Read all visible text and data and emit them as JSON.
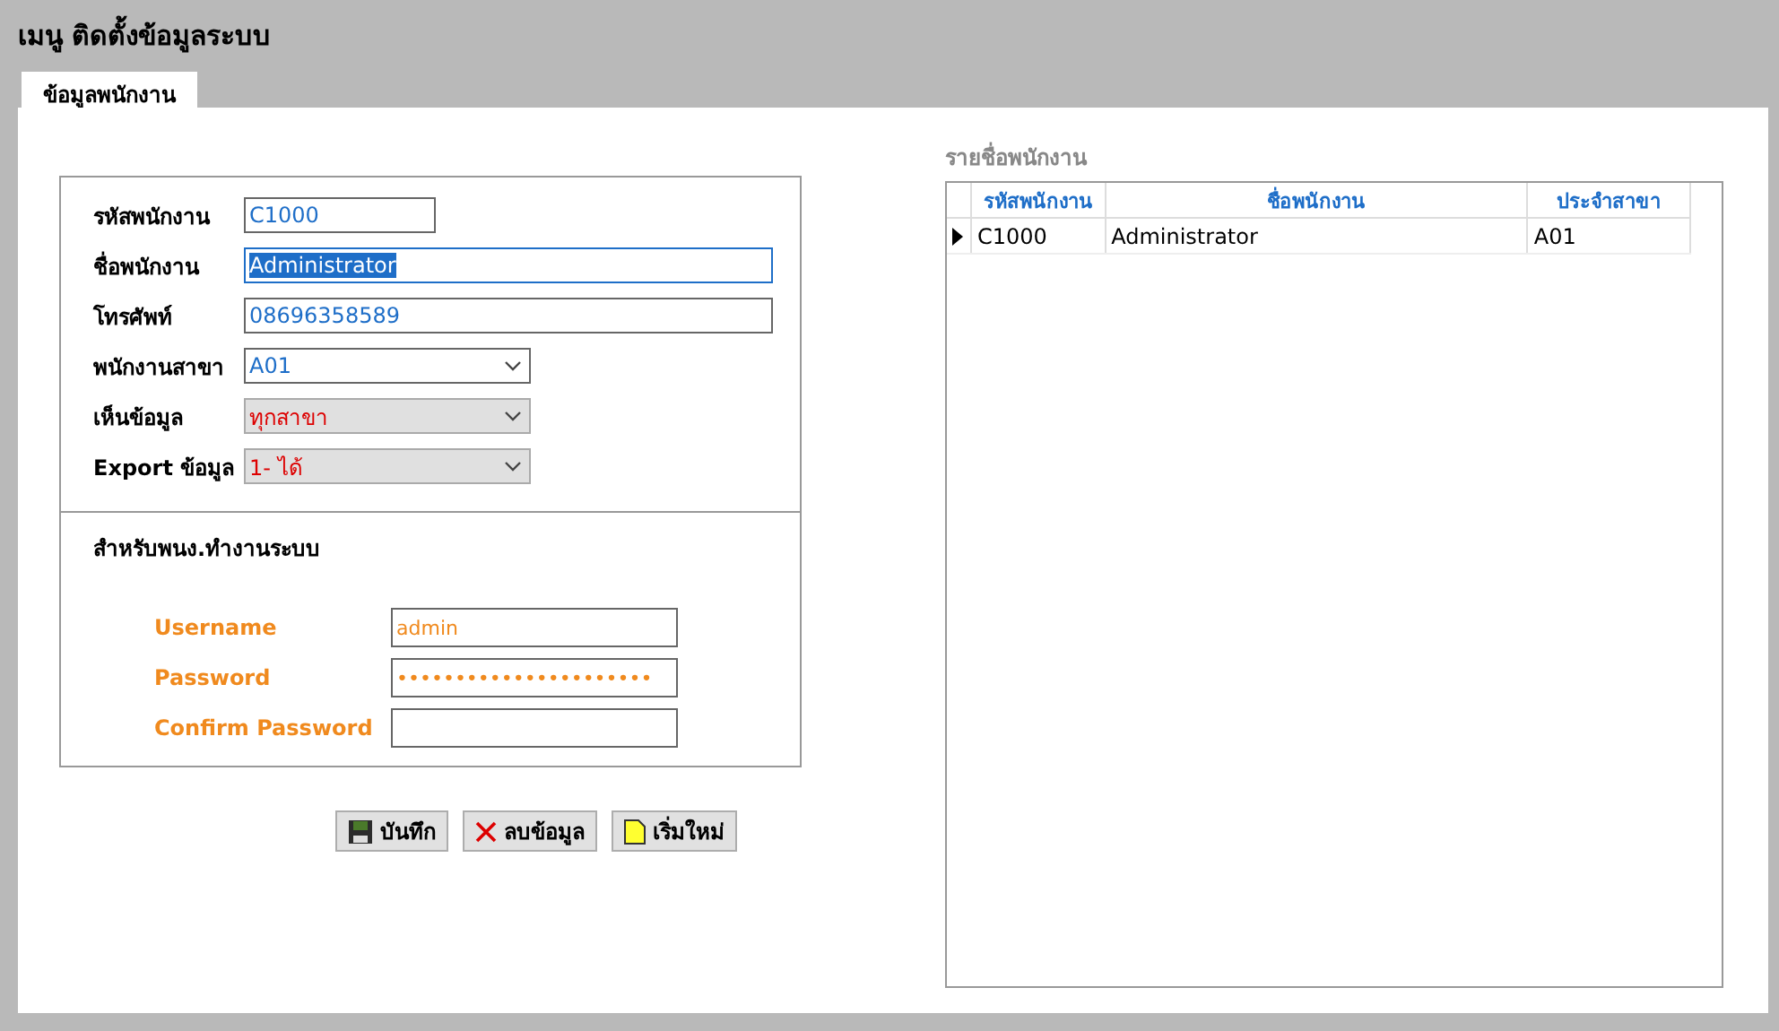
{
  "title": "เมนู ติดตั้งข้อมูลระบบ",
  "tabs": [
    {
      "label": "ข้อมูลพนักงาน",
      "selected": true
    }
  ],
  "employee_form": {
    "fields": [
      {
        "label": "รหัสพนักงาน",
        "kind": "short",
        "value": "C1000",
        "text_selected": false
      },
      {
        "label": "ชื่อพนักงาน",
        "kind": "long",
        "value": "Administrator",
        "text_selected": true
      },
      {
        "label": "โทรศัพท์",
        "kind": "long",
        "value": "08696358589",
        "text_selected": false
      },
      {
        "label": "พนักงานสาขา",
        "kind": "select",
        "value": "A01",
        "disabled": false
      },
      {
        "label": "เห็นข้อมูล",
        "kind": "select",
        "value": "ทุกสาขา",
        "disabled": true
      },
      {
        "label": "Export ข้อมูล",
        "kind": "select",
        "value": "1- ได้",
        "disabled": true
      }
    ]
  },
  "login_section": {
    "heading": "สำหรับพนง.ทำงานระบบ",
    "fields": [
      {
        "label": "Username",
        "value": "admin"
      },
      {
        "label": "Password",
        "value": "••••••••••••••••••••••"
      },
      {
        "label": "Confirm Password"
      }
    ]
  },
  "buttons": [
    {
      "label": "บันทึก",
      "kind": "save"
    },
    {
      "label": "ลบข้อมูล",
      "kind": "delete"
    },
    {
      "label": "เริ่มใหม่",
      "kind": "new"
    }
  ],
  "employee_list": {
    "heading": "รายชื่อพนักงาน",
    "columns": [
      "รหัสพนักงาน",
      "ชื่อพนักงาน",
      "ประจำสาขา"
    ],
    "rows": [
      {
        "cells": [
          "C1000",
          "Administrator",
          "A01"
        ],
        "selected": true
      }
    ]
  }
}
